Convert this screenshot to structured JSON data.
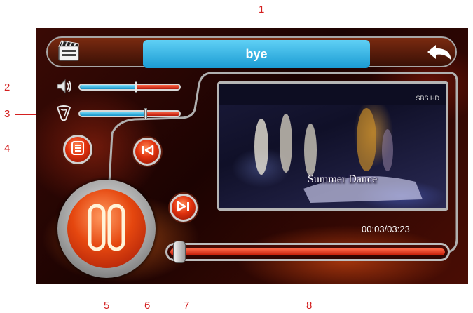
{
  "header": {
    "title": "bye",
    "media_icon": "clapperboard-icon",
    "back_icon": "back-arrow-icon"
  },
  "volume": {
    "icon": "speaker-icon",
    "level": 0.56
  },
  "tone": {
    "icon": "tone-icon",
    "level": 0.66
  },
  "buttons": {
    "playlist_icon": "list-icon",
    "previous_icon": "previous-track-icon",
    "next_icon": "next-track-icon",
    "play_pause_icon": "pause-icon"
  },
  "video": {
    "channel_logo": "SBS HD",
    "caption": "Summer Dance"
  },
  "playback": {
    "time": "00:03/03:23",
    "progress": 0.02
  },
  "callouts": [
    "1",
    "2",
    "3",
    "4",
    "5",
    "6",
    "7",
    "8"
  ],
  "colors": {
    "title_bar": "#1b9bd3",
    "accent_red": "#e1320e",
    "slider_blue": "#1693c9",
    "callout_red": "#d42020"
  }
}
